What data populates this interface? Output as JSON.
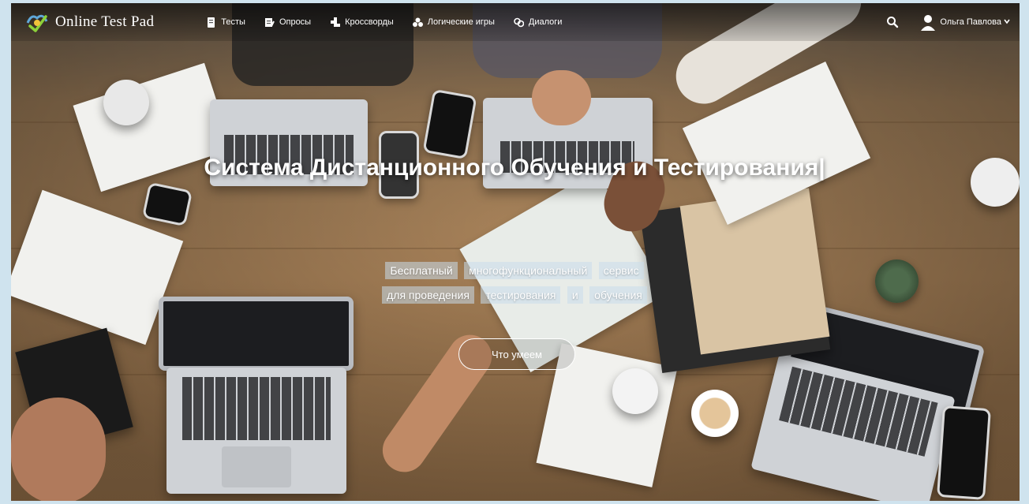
{
  "header": {
    "logo_text": "Online Test Pad",
    "nav": [
      {
        "label": "Тесты",
        "icon": "test-icon"
      },
      {
        "label": "Опросы",
        "icon": "poll-icon"
      },
      {
        "label": "Кроссворды",
        "icon": "crossword-icon"
      },
      {
        "label": "Логические игры",
        "icon": "puzzle-icon"
      },
      {
        "label": "Диалоги",
        "icon": "dialog-icon"
      }
    ],
    "user_name": "Ольга Павлова"
  },
  "hero": {
    "title": "Система Дистанционного Обучения и Тестирования|",
    "tags_row1": [
      "Бесплатный",
      "многофункциональный",
      "сервис"
    ],
    "tags_row2": [
      "для проведения",
      "тестирования",
      "и",
      "обучения"
    ],
    "cta_label": "Что умеем"
  },
  "colors": {
    "nav_text": "#ffffff",
    "tag_bg": "#c8dceb"
  }
}
